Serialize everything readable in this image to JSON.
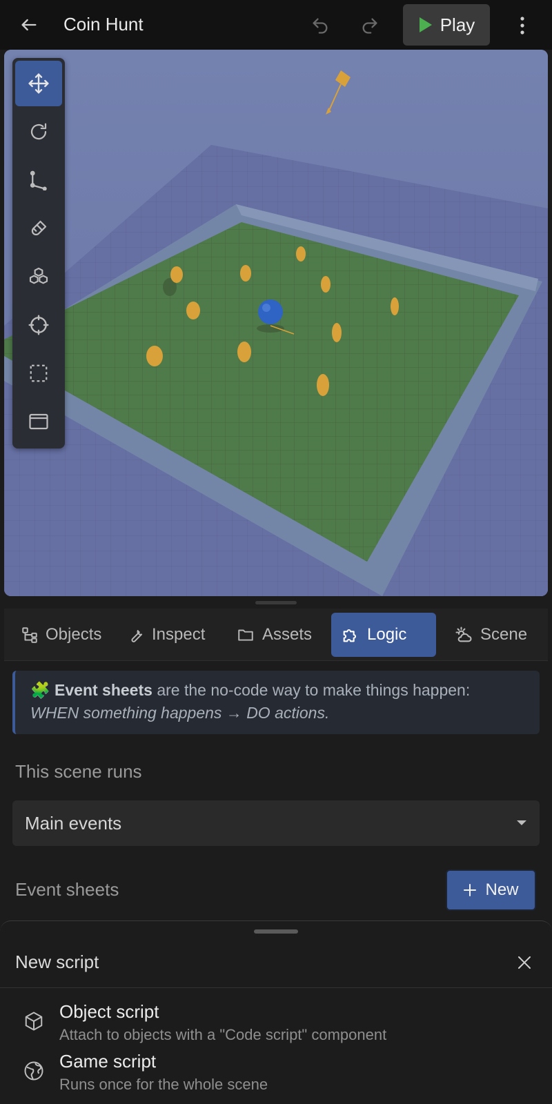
{
  "header": {
    "back_icon": "arrow-left-icon",
    "title": "Coin Hunt",
    "undo_icon": "undo-icon",
    "redo_icon": "redo-icon",
    "play_label": "Play",
    "play_icon": "play-icon",
    "menu_icon": "more-vertical-icon"
  },
  "toolbar": {
    "tools": [
      {
        "name": "move",
        "icon": "move-icon",
        "active": true
      },
      {
        "name": "rotate",
        "icon": "rotate-icon",
        "active": false
      },
      {
        "name": "scale",
        "icon": "scale-icon",
        "active": false
      },
      {
        "name": "snap",
        "icon": "magnet-icon",
        "active": false
      },
      {
        "name": "objects",
        "icon": "cubes-icon",
        "active": false
      },
      {
        "name": "focus",
        "icon": "crosshair-icon",
        "active": false
      },
      {
        "name": "select",
        "icon": "selection-box-icon",
        "active": false
      },
      {
        "name": "panel",
        "icon": "window-icon",
        "active": false
      }
    ]
  },
  "tabs": [
    {
      "label": "Objects",
      "icon": "hierarchy-icon",
      "active": false
    },
    {
      "label": "Inspect",
      "icon": "wrench-icon",
      "active": false
    },
    {
      "label": "Assets",
      "icon": "folder-icon",
      "active": false
    },
    {
      "label": "Logic",
      "icon": "puzzle-icon",
      "active": true
    },
    {
      "label": "Scene",
      "icon": "weather-icon",
      "active": false
    }
  ],
  "banner": {
    "emoji": "🧩",
    "bold": "Event sheets",
    "text": " are the no-code way to make things happen:",
    "italic": "WHEN something happens → DO actions."
  },
  "scene_runs": {
    "label": "This scene runs",
    "selected": "Main events"
  },
  "event_sheets": {
    "label": "Event sheets",
    "new_label": "New"
  },
  "sheet": {
    "title": "New script",
    "options": [
      {
        "title": "Object script",
        "description": "Attach to objects with a \"Code script\" component",
        "icon": "cube-icon"
      },
      {
        "title": "Game script",
        "description": "Runs once for the whole scene",
        "icon": "globe-icon"
      }
    ]
  },
  "colors": {
    "accent": "#3d5a99",
    "play_green": "#4caf50",
    "coin": "#d9a13a"
  }
}
